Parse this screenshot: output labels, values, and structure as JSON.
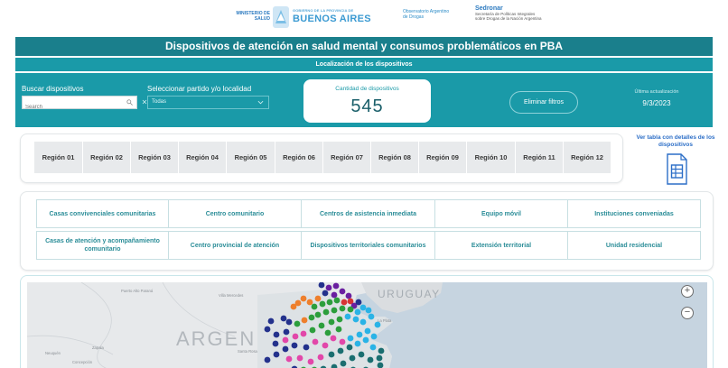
{
  "logos": {
    "ministerio_lines": [
      "MINISTERIO DE",
      "SALUD"
    ],
    "ba_small_lines": [
      "GOBIERNO DE LA PROVINCIA DE"
    ],
    "ba_big": "BUENOS AIRES",
    "observatorio_lines": [
      "Observatorio Argentino",
      "de Drogas"
    ],
    "sedronar_name": "Sedronar",
    "sedronar_lines": [
      "Secretaría de Políticas Integrales",
      "sobre Drogas de la Nación Argentina"
    ]
  },
  "title": "Dispositivos de atención en salud mental y consumos problemáticos en PBA",
  "subtitle": "Localización de los dispositivos",
  "filters": {
    "search_label": "Buscar dispositivos",
    "search_placeholder": "Search",
    "partido_label": "Seleccionar partido y/o localidad",
    "partido_value": "Todas",
    "count_label": "Cantidad de dispositivos",
    "count_value": "545",
    "reset_label": "Eliminar filtros",
    "update_label": "Última actualización",
    "update_date": "9/3/2023"
  },
  "regions": [
    "Región 01",
    "Región 02",
    "Región 03",
    "Región 04",
    "Región 05",
    "Región 06",
    "Región 07",
    "Región 08",
    "Región 09",
    "Región 10",
    "Región 11",
    "Región 12"
  ],
  "side_link": "Ver tabla con detalles de los dispositivos",
  "types": [
    "Casas convivenciales comunitarias",
    "Centro comunitario",
    "Centros de asistencia inmediata",
    "Equipo móvil",
    "Instituciones conveniadas",
    "Casas de atención y acompañamiento comunitario",
    "Centro provincial de atención",
    "Dispositivos territoriales comunitarios",
    "Extensión territorial",
    "Unidad residencial"
  ],
  "map": {
    "labels": {
      "argentina": "ARGEN",
      "uruguay": "URUGUAY",
      "puerto_alto": "Puerto Alto Paraná",
      "villa_mercedes": "Villa Mercedes",
      "santa_rosa": "Santa Rosa",
      "neuquen": "Neuquén",
      "zapala": "Zapala",
      "concepcion": "Concepción",
      "la_plata": "La Plata"
    },
    "zoom_in": "+",
    "zoom_out": "−",
    "colors": {
      "navy": "#23318c",
      "purple": "#6a1fa0",
      "green": "#2c9e3c",
      "orange": "#ee7f2c",
      "cyan": "#2ab3e6",
      "teal": "#1b6e70",
      "magenta": "#e247a9",
      "red": "#d63434"
    }
  }
}
